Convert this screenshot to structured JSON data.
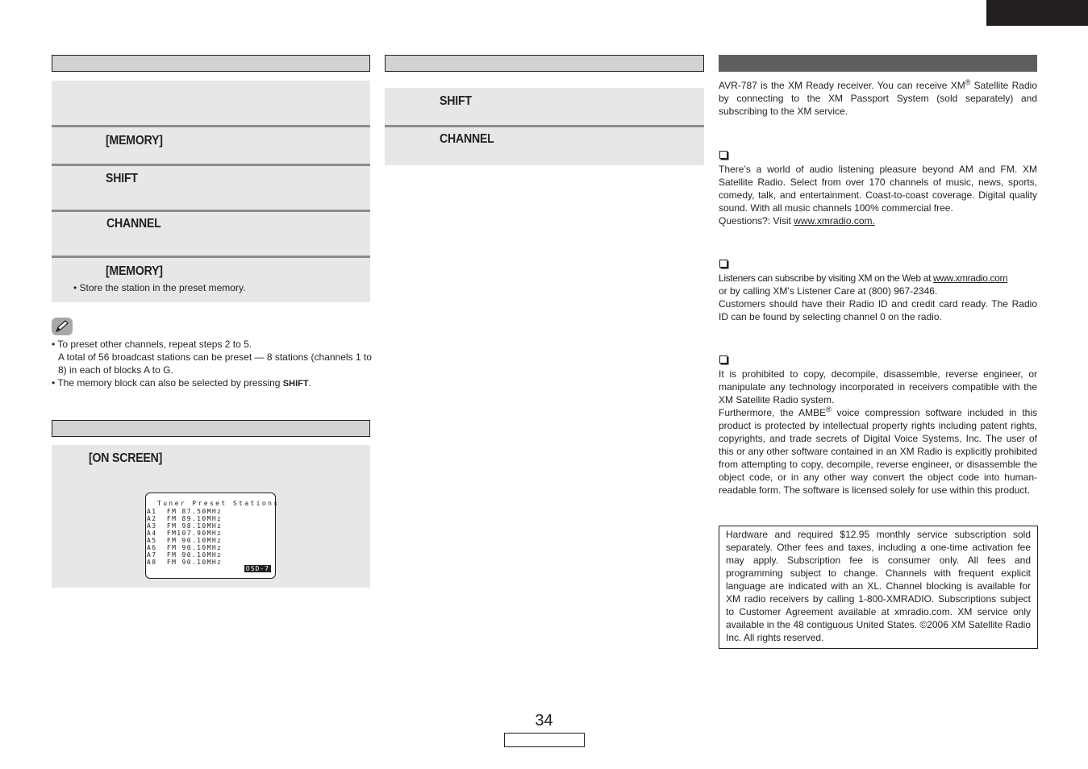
{
  "page": {
    "number": "34"
  },
  "left_column": {
    "preset_steps": [
      {
        "key": ""
      },
      {
        "key": "[MEMORY]"
      },
      {
        "key": "SHIFT"
      },
      {
        "key": "CHANNEL"
      },
      {
        "key": "[MEMORY]",
        "detail": "• Store the station in the preset memory."
      }
    ],
    "notes": {
      "icon": "pencil-icon",
      "items": [
        "• To preset other channels, repeat steps 2 to 5.",
        "A total of 56 broadcast stations can be preset — 8 stations (channels 1 to 8) in each of blocks A to G.",
        "• The memory block can also be selected by pressing ",
        "SHIFT",
        "."
      ]
    },
    "check_presets": {
      "key": "[ON SCREEN]",
      "osd": {
        "title": "Tuner Preset Stations",
        "lines": [
          "A1  FM 87.50MHz",
          "A2  FM 89.10MHz",
          "A3  FM 98.10MHz",
          "A4  FM107.90MHz",
          "A5  FM 90.10MHz",
          "A6  FM 90.10MHz",
          "A7  FM 90.10MHz",
          "A8  FM 90.10MHz"
        ],
        "badge": "OSD-7"
      }
    }
  },
  "middle_column": {
    "steps": [
      {
        "key": "SHIFT"
      },
      {
        "key": "CHANNEL"
      }
    ]
  },
  "right_column": {
    "intro": {
      "part1": "AVR-787 is the XM Ready receiver. You can receive XM",
      "reg": "®",
      "part2": " Satellite Radio by connecting to the XM Passport System (sold separately) and subscribing to the XM service."
    },
    "section1": {
      "icon": "checkbox-icon",
      "text": "There’s a world of audio listening pleasure beyond AM and FM. XM Satellite Radio. Select from over 170 channels of music, news, sports, comedy, talk, and entertainment. Coast-to-coast coverage. Digital quality sound. With all music channels 100% commercial free.",
      "questions_prefix": "Questions?: Visit ",
      "link": "www.xmradio.com."
    },
    "section2": {
      "icon": "checkbox-icon",
      "line1_prefix": "Listeners can subscribe by visiting XM on the Web at ",
      "link": "www.xmradio.com",
      "line2": "or by calling XM’s Listener Care at (800) 967-2346.",
      "text2": "Customers should have their Radio ID and credit card ready. The Radio ID can be found by selecting channel 0 on the radio."
    },
    "section3": {
      "icon": "checkbox-icon",
      "text1": "It is prohibited to copy, decompile, disassemble, reverse engineer, or manipulate any technology incorporated in receivers compatible with the XM Satellite Radio system.",
      "text2_part1": "Furthermore, the AMBE",
      "reg": "®",
      "text2_part2": " voice compression software included in this product is protected by intellectual property rights including patent rights, copyrights, and trade secrets of Digital Voice Systems, Inc. The user of this or any other software contained in an XM Radio is explicitly prohibited from attempting to copy, decompile, reverse engineer, or disassemble the object code, or in any other way convert the object code into human-readable form. The software is licensed solely for use within this product."
    },
    "disclaimer": "Hardware and required $12.95 monthly service subscription sold separately. Other fees and taxes, including a one-time activation fee may apply. Subscription fee is consumer only. All fees and programming subject to change. Channels with frequent explicit language are indicated with an XL. Channel blocking is available for XM radio receivers by calling 1-800-XMRADIO. Subscriptions subject to Customer Agreement available at xmradio.com. XM service only available in the 48 contiguous United States. ©2006 XM Satellite Radio Inc. All rights reserved."
  },
  "colors": {
    "text": "#231f20",
    "header_light": "#d2d2d2",
    "header_dark": "#5f5f5f",
    "step_background": "#e7e7e7",
    "divider": "#8c8c8c"
  }
}
